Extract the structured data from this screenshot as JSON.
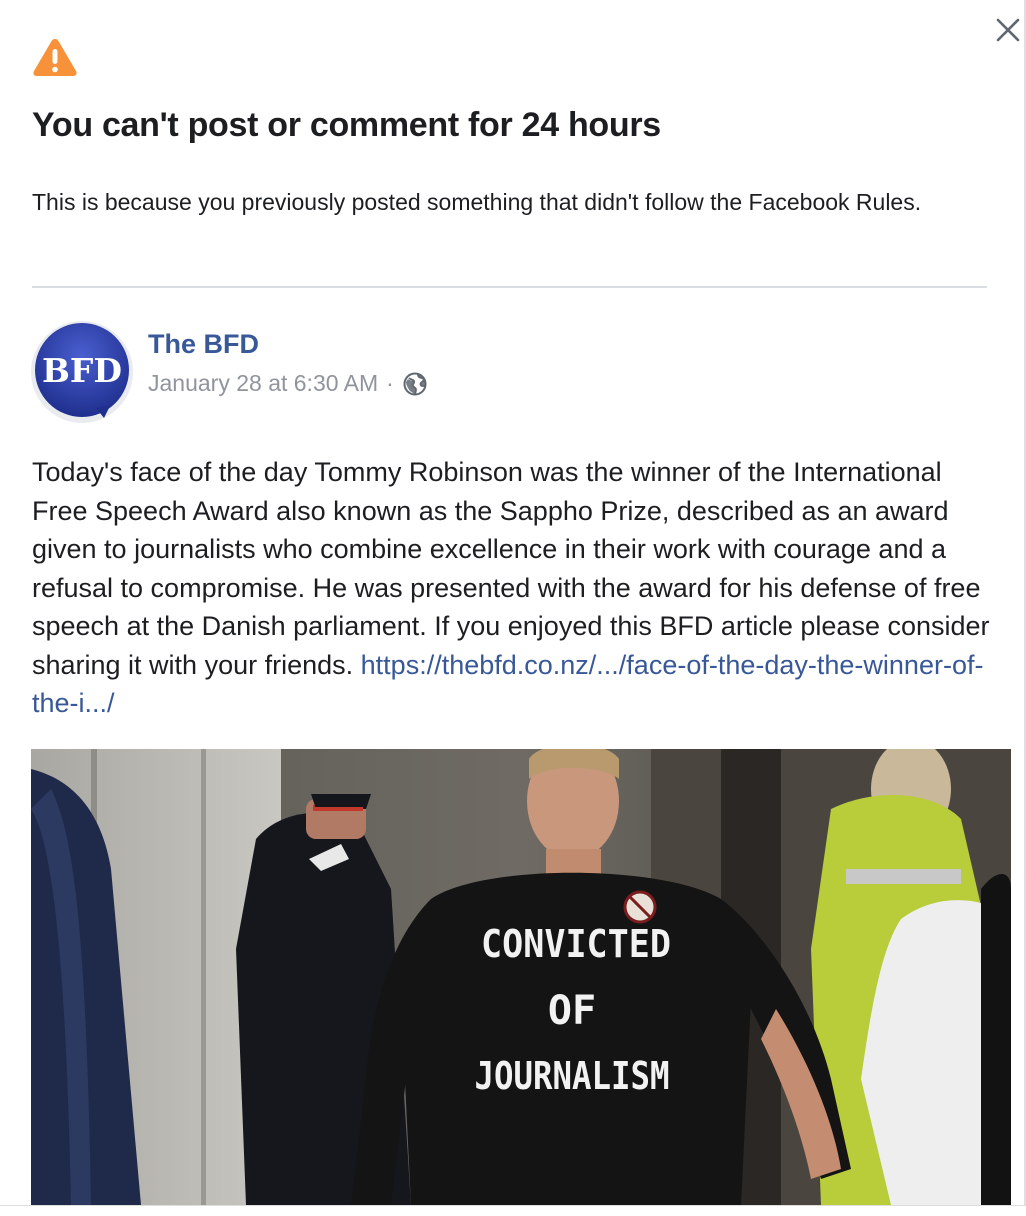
{
  "dialog": {
    "title": "You can't post or comment for 24 hours",
    "subtitle": "This is because you previously posted something that didn't follow the Facebook Rules.",
    "close_icon": "close-icon",
    "warning_icon": "warning-triangle-icon",
    "warning_color": "#f7923b"
  },
  "post": {
    "avatar_text": "BFD",
    "page_name": "The BFD",
    "timestamp": "January 28 at 6:30 AM",
    "separator": "·",
    "privacy_icon": "globe-icon",
    "body": "Today's face of the day Tommy Robinson was the winner of the International Free Speech Award also known as the Sappho Prize, described as an award given to journalists who combine excellence in their work with courage and a refusal to compromise. He was presented with the award for his defense of free speech at the Danish parliament. If you enjoyed this BFD article please consider sharing it with your friends.",
    "link": "https://thebfd.co.nz/.../face-of-the-day-the-winner-of-the-i.../",
    "image": {
      "shirt_line_1": "CONVICTED",
      "shirt_line_2": "OF",
      "shirt_line_3": "JOURNALISM"
    }
  },
  "colors": {
    "link": "#385898",
    "text": "#1c1e21",
    "meta": "#90949c",
    "avatar_blue": "#2c3fa8"
  }
}
